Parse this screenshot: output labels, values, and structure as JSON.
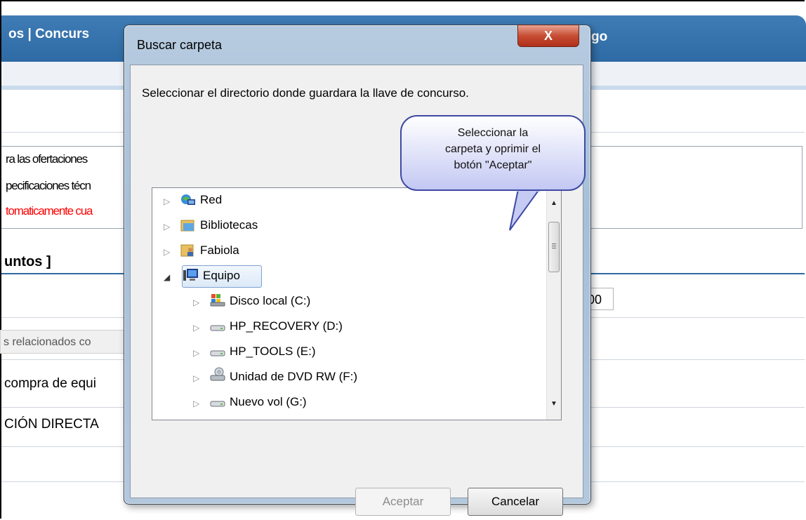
{
  "background": {
    "nav_left": "os  |  Concurs",
    "nav_right": "go",
    "info_lines": [
      "ra las ofertaciones",
      "pecificaciones técn",
      "tomaticamente cua"
    ],
    "section_heading": "untos ]",
    "field_value": "00",
    "related_label": "s relacionados co",
    "row_text_1": "compra de equi",
    "row_text_2": "CIÓN DIRECTA"
  },
  "dialog": {
    "title": "Buscar carpeta",
    "close_label": "X",
    "description": "Seleccionar el directorio donde guardara la llave de concurso.",
    "tree": [
      {
        "label": "Red",
        "icon": "network-icon",
        "expanded": false
      },
      {
        "label": "Bibliotecas",
        "icon": "libraries-icon",
        "expanded": false
      },
      {
        "label": "Fabiola",
        "icon": "user-folder-icon",
        "expanded": false
      },
      {
        "label": "Equipo",
        "icon": "computer-icon",
        "expanded": true,
        "selected": true
      },
      {
        "label": "Disco local (C:)",
        "icon": "system-drive-icon",
        "expanded": false
      },
      {
        "label": "HP_RECOVERY (D:)",
        "icon": "drive-icon",
        "expanded": false
      },
      {
        "label": "HP_TOOLS (E:)",
        "icon": "drive-icon",
        "expanded": false
      },
      {
        "label": "Unidad de DVD RW (F:)",
        "icon": "dvd-drive-icon",
        "expanded": false
      },
      {
        "label": "Nuevo vol (G:)",
        "icon": "drive-icon",
        "expanded": false
      }
    ],
    "ok_label": "Aceptar",
    "cancel_label": "Cancelar"
  },
  "callout": {
    "lines": [
      "Seleccionar la",
      "carpeta y oprimir el",
      "botón \"Aceptar\""
    ]
  },
  "colors": {
    "topbar": "#2e6aa3",
    "highlight_text": "#ff0000",
    "callout_border": "#3e4aa3"
  }
}
